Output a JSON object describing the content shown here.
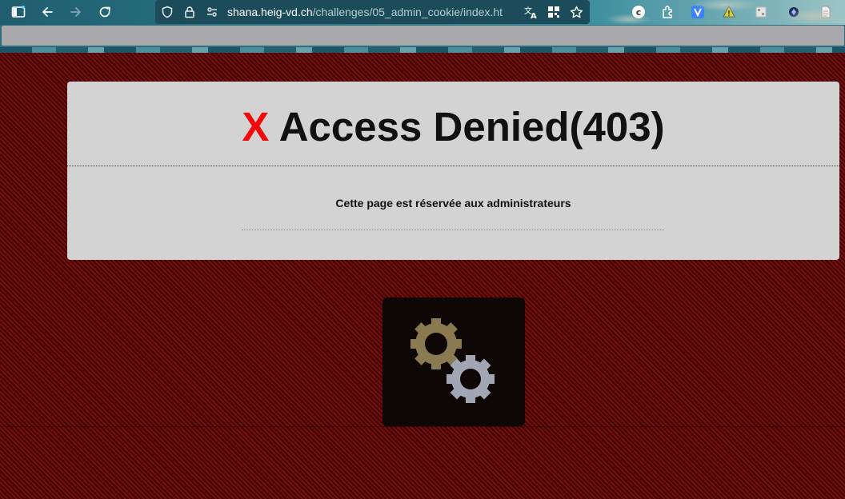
{
  "browser": {
    "url_host": "shana.heig-vd.ch",
    "url_path": "/challenges/05_admin_cookie/index.ht",
    "toolbar_icons": [
      "sidebar-icon",
      "back-icon",
      "forward-icon",
      "reload-icon",
      "shield-icon",
      "lock-icon",
      "permissions-icon",
      "translate-icon",
      "qr-icon",
      "bookmark-star-icon",
      "extension-c-icon",
      "extensions-puzzle-icon",
      "extension-v-icon",
      "extension-warning-icon",
      "extension-grid-icon",
      "extension-diamond-icon",
      "extension-doc-icon"
    ]
  },
  "page": {
    "title_mark": "X",
    "title_text": " Access Denied(403)",
    "subtitle": "Cette page est réservée aux administrateurs"
  },
  "colors": {
    "title_mark": "#f20a0a",
    "panel_bg": "#d3d3d3",
    "page_stripe_dark": "#3c0505",
    "page_stripe_light": "#7a0e0e",
    "gear_gold": "#8a7a52",
    "gear_silver": "#a2a6b4"
  }
}
